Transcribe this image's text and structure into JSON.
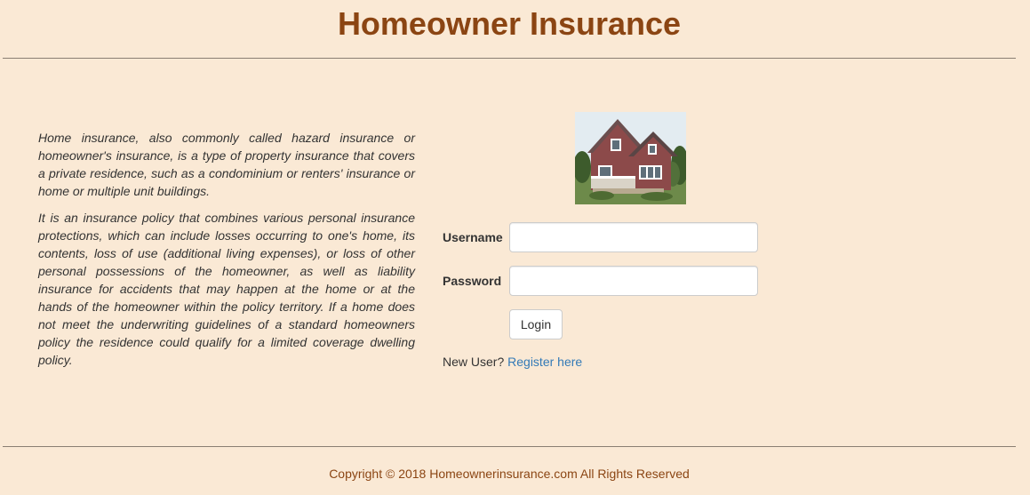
{
  "header": {
    "title": "Homeowner Insurance"
  },
  "description": {
    "paragraphs": [
      "Home insurance, also commonly called hazard insurance or homeowner's insurance, is a type of property insurance that covers a private residence, such as a condominium or renters' insurance or home or multiple unit buildings.",
      "It is an insurance policy that combines various personal insurance protections, which can include losses occurring to one's home, its contents, loss of use (additional living expenses), or loss of other personal possessions of the homeowner, as well as liability insurance for accidents that may happen at the home or at the hands of the homeowner within the policy territory. If a home does not meet the underwriting guidelines of a standard homeowners policy the residence could qualify for a limited coverage dwelling policy."
    ]
  },
  "login": {
    "username_label": "Username",
    "username_value": "",
    "password_label": "Password",
    "password_value": "",
    "login_button": "Login",
    "new_user_text": "New User?",
    "register_link": "Register here"
  },
  "footer": {
    "copyright": "Copyright © 2018 Homeownerinsurance.com All Rights Reserved"
  },
  "colors": {
    "background": "#fae9d5",
    "title": "#8b4513",
    "link": "#337ab7"
  }
}
